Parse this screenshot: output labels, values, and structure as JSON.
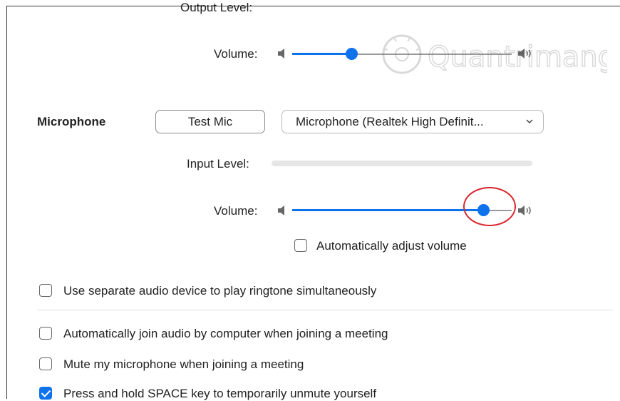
{
  "speaker": {
    "output_level_label": "Output Level:",
    "volume_label": "Volume:",
    "volume_level": 0.27
  },
  "microphone": {
    "section_label": "Microphone",
    "test_button": "Test Mic",
    "device_selected": "Microphone (Realtek High Definit...",
    "input_level_label": "Input Level:",
    "volume_label": "Volume:",
    "volume_level": 0.87,
    "auto_adjust_label": "Automatically adjust volume",
    "auto_adjust_checked": false
  },
  "options": [
    {
      "label": "Use separate audio device to play ringtone simultaneously",
      "checked": false
    },
    {
      "label": "Automatically join audio by computer when joining a meeting",
      "checked": false
    },
    {
      "label": "Mute my microphone when joining a meeting",
      "checked": false
    },
    {
      "label": "Press and hold SPACE key to temporarily unmute yourself",
      "checked": true
    }
  ],
  "watermark_text": "Quantrimang",
  "colors": {
    "accent": "#0e72ed",
    "highlight": "#d9262c"
  },
  "icons": [
    "speaker-low-icon",
    "speaker-high-icon",
    "chevron-down-icon",
    "checkmark-icon"
  ]
}
